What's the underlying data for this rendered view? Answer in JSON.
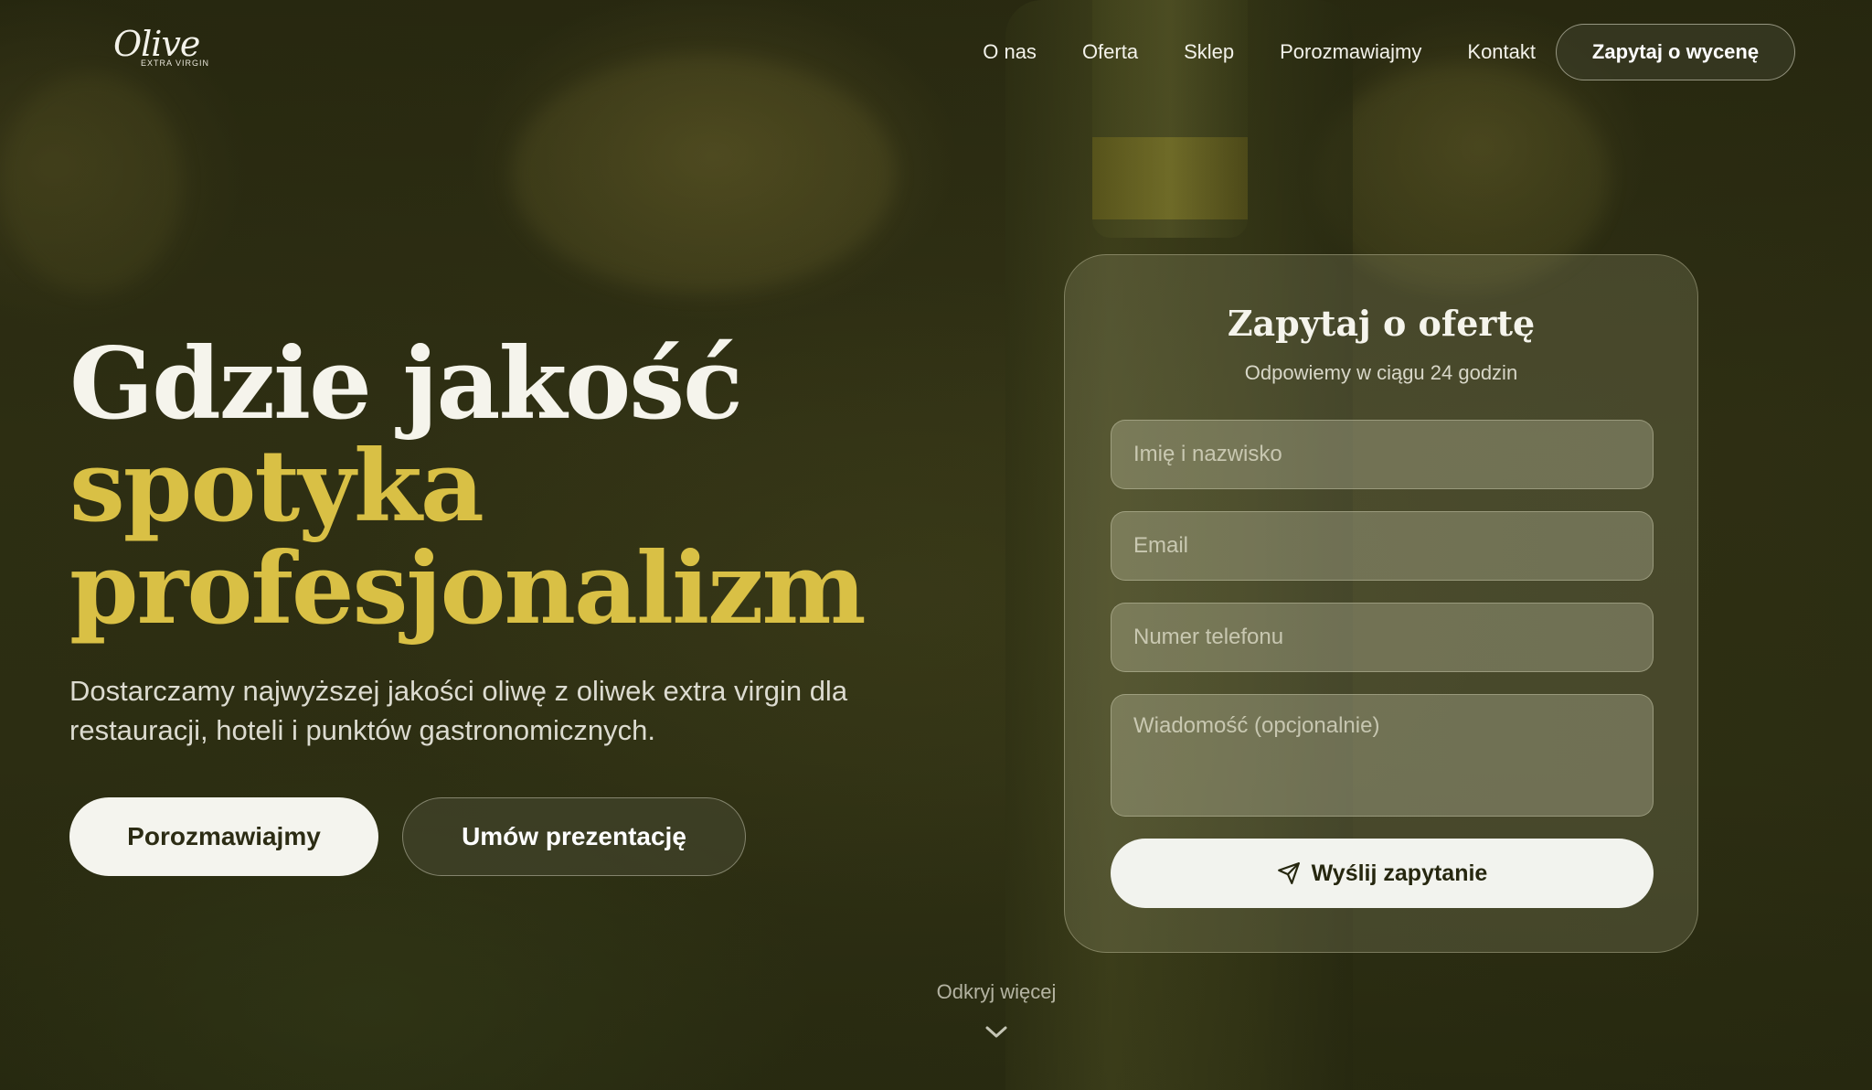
{
  "brand": {
    "logo_word": "Olive",
    "logo_sub": "EXTRA VIRGIN"
  },
  "nav": {
    "links": [
      "O nas",
      "Oferta",
      "Sklep",
      "Porozmawiajmy",
      "Kontakt"
    ],
    "cta": "Zapytaj o wycenę"
  },
  "hero": {
    "title_line1": "Gdzie jakość",
    "title_line2": "spotyka",
    "title_line3": "profesjonalizm",
    "subtitle": "Dostarczamy najwyższej jakości oliwę z oliwek extra virgin dla restauracji, hoteli i punktów gastronomicznych.",
    "primary_button": "Porozmawiajmy",
    "secondary_button": "Umów prezentację"
  },
  "form": {
    "title": "Zapytaj o ofertę",
    "subtitle": "Odpowiemy w ciągu 24 godzin",
    "name_placeholder": "Imię i nazwisko",
    "email_placeholder": "Email",
    "phone_placeholder": "Numer telefonu",
    "message_placeholder": "Wiadomość (opcjonalnie)",
    "submit_label": "Wyślij zapytanie"
  },
  "discover": {
    "label": "Odkryj więcej"
  },
  "colors": {
    "accent_gold": "#d9c045",
    "background_olive": "#333416",
    "button_light": "#f4f4ee"
  }
}
